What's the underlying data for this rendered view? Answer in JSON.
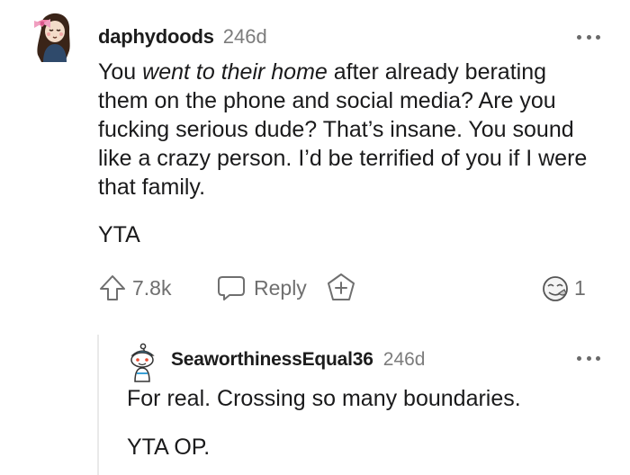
{
  "comment": {
    "author": "daphydoods",
    "age": "246d",
    "body_parts": [
      {
        "text": "You ",
        "italic": false
      },
      {
        "text": "went to their home",
        "italic": true
      },
      {
        "text": " after already berating them on the phone and social media? Are you fucking serious dude? That’s insane. You sound like a crazy person. I’d be terrified of you if I were that family.",
        "italic": false
      }
    ],
    "verdict": "YTA",
    "upvotes": "7.8k",
    "reply_label": "Reply",
    "award_count": "1",
    "avatar_icon": "avatar-girl-with-bow-icon",
    "upvote_icon": "upvote-arrow-icon",
    "reply_icon": "speech-bubble-icon",
    "award_icon": "add-award-icon",
    "awardee_icon": "awarded-face-icon",
    "more_icon": "more-options-icon"
  },
  "reply": {
    "author": "SeaworthinessEqual36",
    "age": "246d",
    "body": "For real. Crossing so many boundaries.",
    "verdict": "YTA OP.",
    "avatar_icon": "avatar-snoo-icon",
    "more_icon": "more-options-icon"
  },
  "colors": {
    "text": "#1a1a1b",
    "meta": "#7c7c7c",
    "action": "#6f6f6f",
    "thread_line": "#e9e9e9"
  }
}
